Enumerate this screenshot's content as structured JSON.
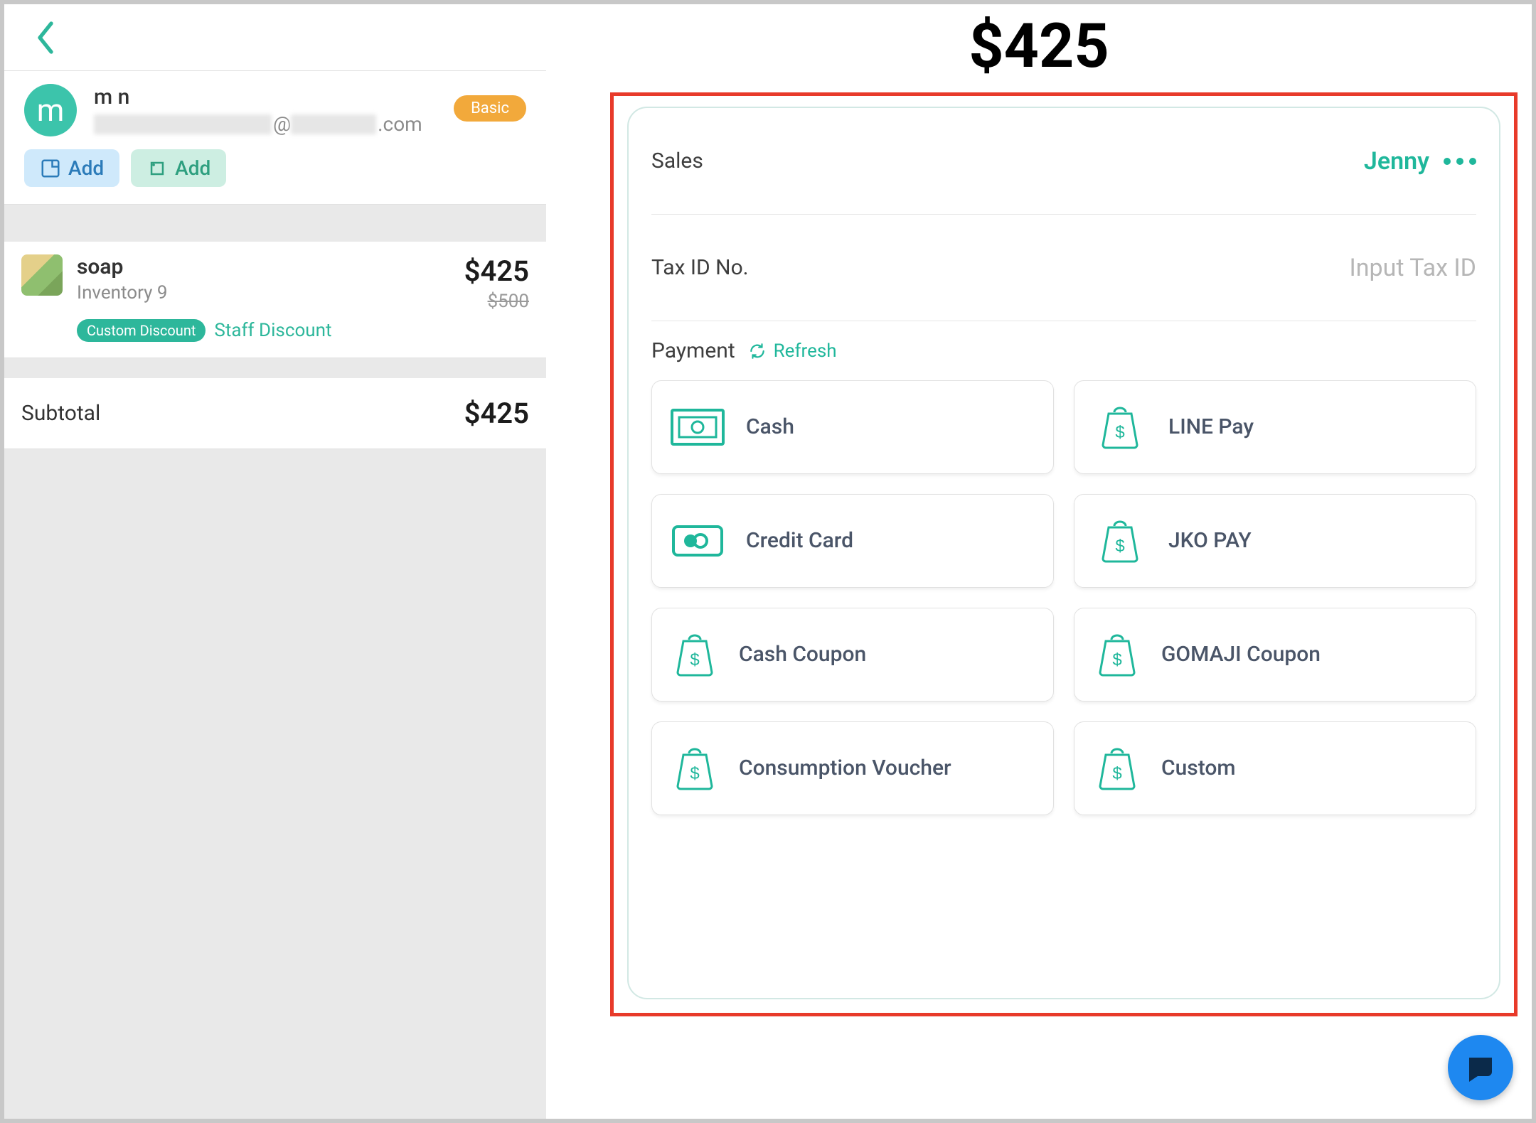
{
  "total": "$425",
  "customer": {
    "initial": "m",
    "name": "m n",
    "email_suffix": ".com",
    "email_at": "@",
    "badge": "Basic",
    "add_note": "Add",
    "add_tag": "Add"
  },
  "item": {
    "name": "soap",
    "inventory": "Inventory 9",
    "price": "$425",
    "original": "$500",
    "discount_pill": "Custom Discount",
    "discount_text": "Staff Discount"
  },
  "subtotal": {
    "label": "Subtotal",
    "amount": "$425"
  },
  "checkout": {
    "sales_label": "Sales",
    "sales_name": "Jenny",
    "tax_label": "Tax ID No.",
    "tax_placeholder": "Input Tax ID",
    "payment_label": "Payment",
    "refresh": "Refresh",
    "methods": [
      {
        "label": "Cash",
        "icon": "cash"
      },
      {
        "label": "LINE Pay",
        "icon": "bag"
      },
      {
        "label": "Credit Card",
        "icon": "card"
      },
      {
        "label": "JKO PAY",
        "icon": "bag"
      },
      {
        "label": "Cash Coupon",
        "icon": "bag"
      },
      {
        "label": "GOMAJI Coupon",
        "icon": "bag"
      },
      {
        "label": "Consumption Voucher",
        "icon": "bag"
      },
      {
        "label": "Custom",
        "icon": "bag"
      }
    ]
  }
}
